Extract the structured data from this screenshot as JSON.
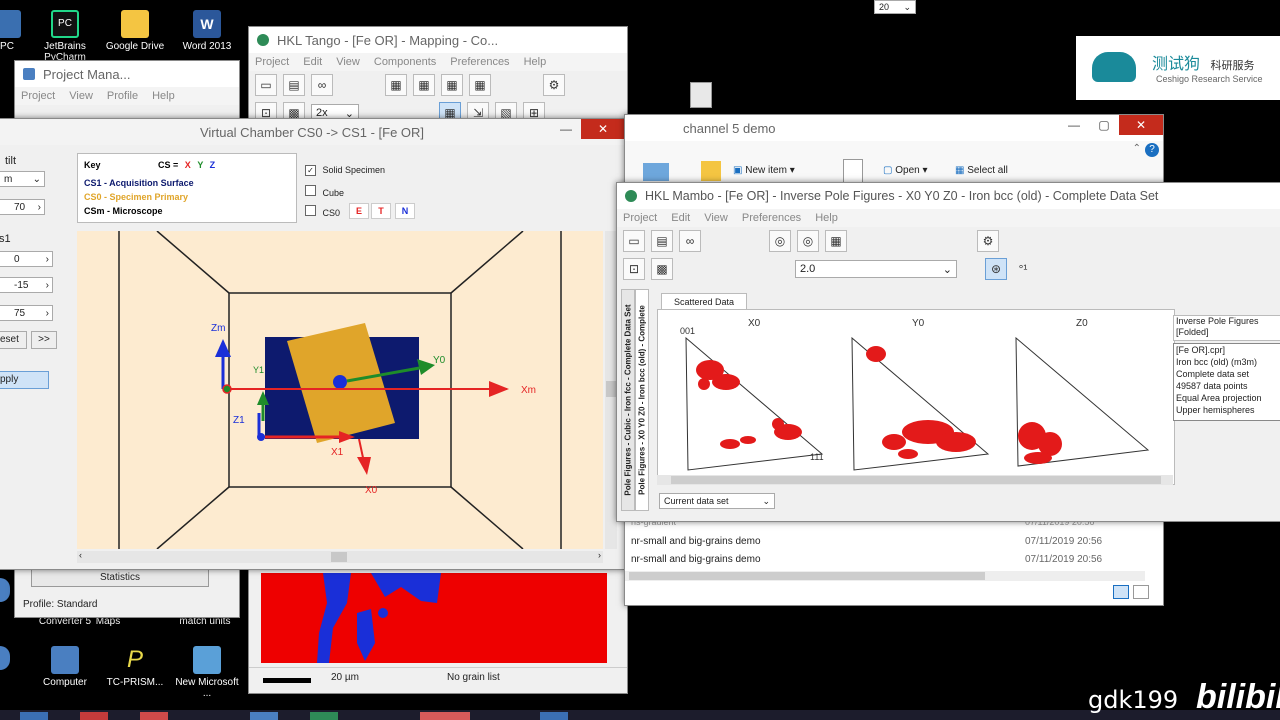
{
  "desktop": {
    "icons_top": [
      {
        "label": "PC",
        "color": "#3a6fb0"
      },
      {
        "label": "JetBrains PyCharm",
        "color": "#21d789"
      },
      {
        "label": "Google Drive",
        "color": "#f4b400"
      },
      {
        "label": "Word 2013",
        "color": "#2b579a"
      }
    ],
    "icons_bottom": [
      {
        "label": "Computer",
        "color": "#4a7fc1"
      },
      {
        "label": "TC-PRISM...",
        "color": "#e8d94a"
      },
      {
        "label": "New Microsoft ...",
        "color": "#5aa0d8"
      }
    ],
    "icons_mid": [
      "Converter 5",
      "Maps",
      "match units"
    ],
    "top_combo_value": "20"
  },
  "watermark": {
    "text": "gdk199",
    "logo": "bilibili",
    "brand_cn": "测试狗",
    "brand_cn2": "科研服务",
    "brand_en": "Ceshigo Research Service"
  },
  "tango": {
    "title": "HKL Tango - [Fe OR] - Mapping - Co...",
    "menu": [
      "Project",
      "Edit",
      "View",
      "Components",
      "Preferences",
      "Help"
    ],
    "zoom_value": "2x",
    "scale_label": "20 µm",
    "grain_status": "No grain list"
  },
  "project_manager": {
    "title": "Project Mana...",
    "menu": [
      "Project",
      "View",
      "Profile",
      "Help"
    ],
    "statistics_button": "Statistics",
    "profile_label": "Profile: Standard"
  },
  "chamber": {
    "title": "Virtual Chamber CS0 -> CS1 - [Fe OR]",
    "left_labels": [
      "tilt",
      "m",
      "70",
      "s1",
      "0",
      "-15",
      "75",
      "eset",
      ">>",
      "pply"
    ],
    "key": {
      "key_label": "Key",
      "cs_label": "CS =",
      "x": "X",
      "y": "Y",
      "z": "Z",
      "cs1": "CS1 - Acquisition Surface",
      "cs0": "CS0 - Specimen Primary",
      "csm": "CSm - Microscope"
    },
    "options": {
      "solid_specimen": "Solid Specimen",
      "cube": "Cube",
      "cs0": "CS0",
      "btn_e": "E",
      "btn_t": "T",
      "btn_n": "N"
    },
    "axis_labels": {
      "zm": "Zm",
      "xm": "Xm",
      "y0": "Y0",
      "y1": "Y1",
      "z1": "Z1",
      "x1": "X1",
      "x0": "X0"
    },
    "colors": {
      "background": "#fdebd0",
      "navy": "#0d1a6e",
      "gold": "#e0a52a",
      "red": "#e52424",
      "blue": "#1a2fd8",
      "green": "#1e8c2a"
    }
  },
  "explorer": {
    "title": "channel 5 demo",
    "new_item": "New item",
    "open": "Open",
    "select_all": "Select all",
    "rows": [
      {
        "name": "ns-gradient",
        "date": "07/11/2019 20:56"
      },
      {
        "name": "nr-small and big-grains demo",
        "date": "07/11/2019 20:56"
      },
      {
        "name": "nr-small and big-grains demo",
        "date": "07/11/2019 20:56"
      }
    ]
  },
  "mambo": {
    "title": "HKL Mambo - [Fe OR] - Inverse Pole Figures - X0 Y0 Z0 - Iron bcc (old) - Complete Data Set",
    "menu": [
      "Project",
      "Edit",
      "View",
      "Preferences",
      "Help"
    ],
    "combo_value": "2.0",
    "tab": "Scattered Data",
    "side_vertical": [
      "Pole Figures - Cubic - Iron fcc - Complete Data Set",
      "Pole Figures - X0 Y0 Z0 - Iron bcc (old) - Complete"
    ],
    "fig_labels": [
      "X0",
      "Y0",
      "Z0"
    ],
    "corner_001": "001",
    "corner_111": "111",
    "info_header": [
      "Inverse Pole Figures",
      "[Folded]"
    ],
    "info_lines": [
      "[Fe OR].cpr]",
      "Iron bcc (old) (m3m)",
      "Complete data set",
      "49587 data points",
      "Equal Area projection",
      "Upper hemispheres"
    ],
    "dataset_value": "Current data set"
  }
}
